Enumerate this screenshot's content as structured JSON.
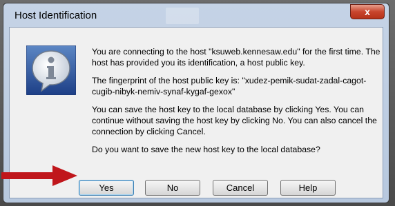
{
  "dialog": {
    "title": "Host Identification",
    "close_symbol": "x",
    "icon": "info-icon",
    "paragraphs": [
      "You are connecting to the host \"ksuweb.kennesaw.edu\" for the first time. The host has provided you its identification, a host public key.",
      "The fingerprint of the host public key is: \"xudez-pemik-sudat-zadal-cagot-cugib-nibyk-nemiv-synaf-kygaf-gexox\"",
      "You can save the host key to the local database by clicking Yes. You can continue without saving the host key by clicking No. You can also cancel the connection by clicking Cancel.",
      "Do you want to save the new host key to the local database?"
    ],
    "buttons": {
      "yes": "Yes",
      "no": "No",
      "cancel": "Cancel",
      "help": "Help"
    }
  },
  "annotation": {
    "arrow_color": "#c0161b"
  }
}
